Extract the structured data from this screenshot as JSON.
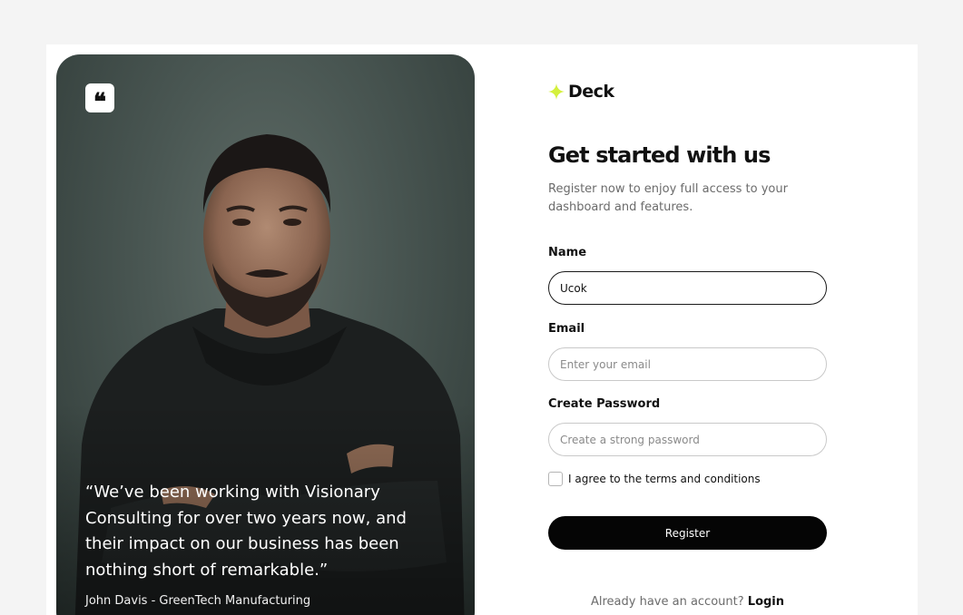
{
  "brand": {
    "name": "Deck",
    "accent": "#d4f03c"
  },
  "testimonial": {
    "quote": "“We’ve been working with Visionary Consulting for over two years now, and their impact on our business has been nothing short of remarkable.”",
    "author": "John Davis - GreenTech Manufacturing",
    "quote_glyph": "❝"
  },
  "form": {
    "title": "Get started with us",
    "subtitle": "Register now to enjoy full access to your dashboard and features.",
    "name": {
      "label": "Name",
      "value": "Ucok"
    },
    "email": {
      "label": "Email",
      "placeholder": "Enter your email"
    },
    "password": {
      "label": "Create Password",
      "placeholder": "Create a strong password"
    },
    "terms_label": "I agree to the terms and conditions",
    "register_label": "Register",
    "login_prompt": "Already have an account?",
    "login_label": "Login"
  }
}
